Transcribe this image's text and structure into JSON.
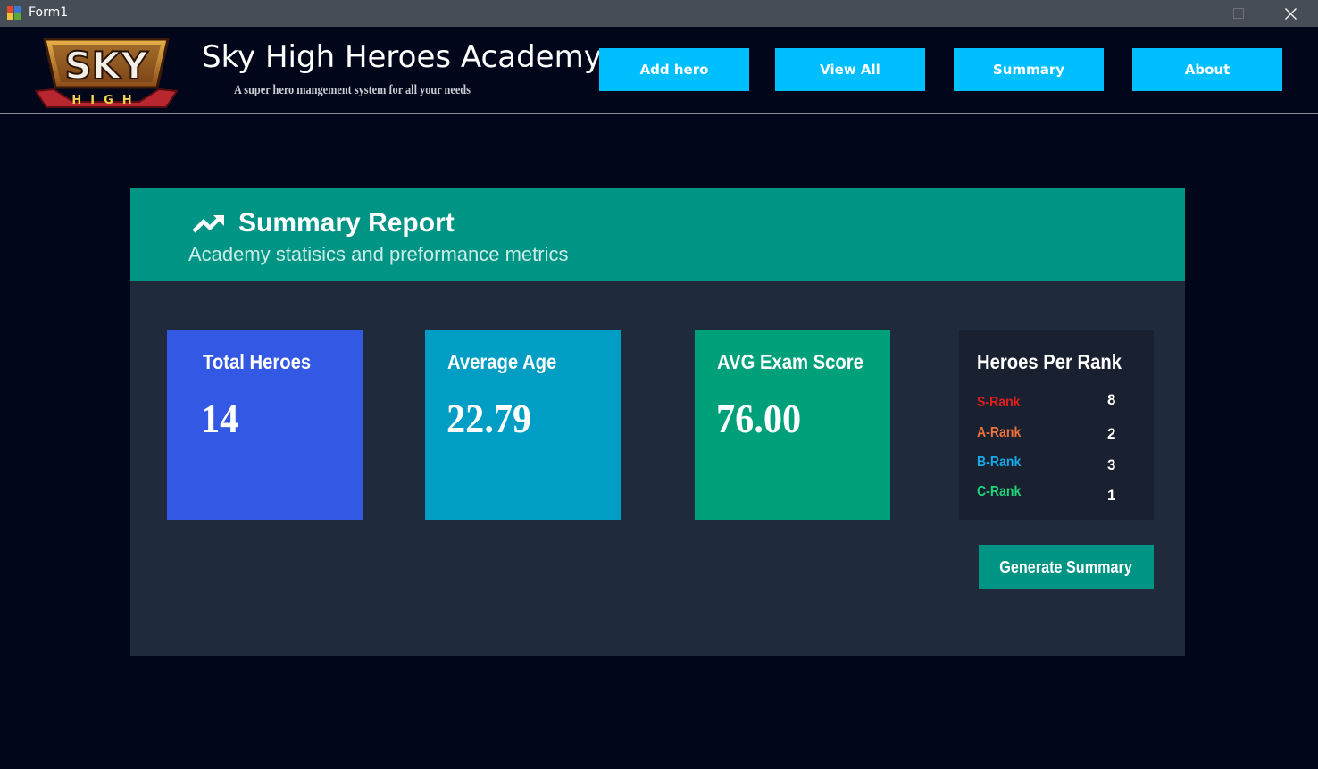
{
  "window": {
    "title": "Form1",
    "controls": {
      "minimize": "—",
      "maximize": "☐",
      "close": "✕"
    }
  },
  "header": {
    "logo_text": "SKY",
    "logo_subtext": "HIGH",
    "title": "Sky High Heroes Academy",
    "subtitle": "A super hero mangement system for all your needs",
    "nav": {
      "add_hero": "Add hero",
      "view_all": "View All",
      "summary": "Summary",
      "about": "About"
    },
    "colors": {
      "nav_button": "#00bfff"
    }
  },
  "report": {
    "title": "Summary Report",
    "subtitle": "Academy statisics and preformance metrics",
    "icon": "trending-up-icon",
    "cards": {
      "total_heroes": {
        "label": "Total Heroes",
        "value": "14",
        "color": "#3358e3"
      },
      "average_age": {
        "label": "Average Age",
        "value": "22.79",
        "color": "#009dc4"
      },
      "avg_exam_score": {
        "label": "AVG Exam Score",
        "value": "76.00",
        "color": "#00a07a"
      }
    },
    "ranks": {
      "title": "Heroes Per Rank",
      "items": [
        {
          "name": "S-Rank",
          "count": "8",
          "color": "#e01e1e"
        },
        {
          "name": "A-Rank",
          "count": "2",
          "color": "#f0703a"
        },
        {
          "name": "B-Rank",
          "count": "3",
          "color": "#18a8e8"
        },
        {
          "name": "C-Rank",
          "count": "1",
          "color": "#1ed67a"
        }
      ]
    },
    "generate_button": "Generate Summary"
  }
}
